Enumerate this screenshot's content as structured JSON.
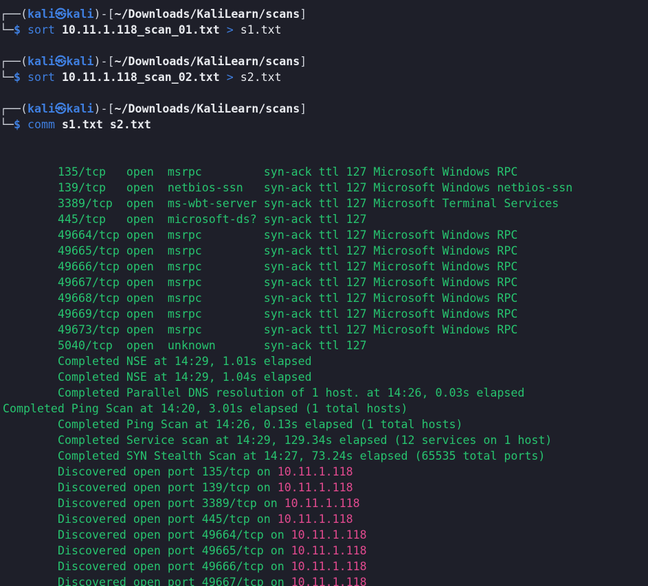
{
  "prompts": [
    {
      "user": "kali",
      "host": "kali",
      "path": "~/Downloads/KaliLearn/scans",
      "command": "sort",
      "arg_bold": "10.11.1.118_scan_01.txt",
      "redirect": ">",
      "arg_plain": "s1.txt"
    },
    {
      "user": "kali",
      "host": "kali",
      "path": "~/Downloads/KaliLearn/scans",
      "command": "sort",
      "arg_bold": "10.11.1.118_scan_02.txt",
      "redirect": ">",
      "arg_plain": "s2.txt"
    },
    {
      "user": "kali",
      "host": "kali",
      "path": "~/Downloads/KaliLearn/scans",
      "command": "comm",
      "arg_bold": "s1.txt s2.txt",
      "redirect": "",
      "arg_plain": ""
    }
  ],
  "output": {
    "ports": [
      "135/tcp   open  msrpc         syn-ack ttl 127 Microsoft Windows RPC",
      "139/tcp   open  netbios-ssn   syn-ack ttl 127 Microsoft Windows netbios-ssn",
      "3389/tcp  open  ms-wbt-server syn-ack ttl 127 Microsoft Terminal Services",
      "445/tcp   open  microsoft-ds? syn-ack ttl 127",
      "49664/tcp open  msrpc         syn-ack ttl 127 Microsoft Windows RPC",
      "49665/tcp open  msrpc         syn-ack ttl 127 Microsoft Windows RPC",
      "49666/tcp open  msrpc         syn-ack ttl 127 Microsoft Windows RPC",
      "49667/tcp open  msrpc         syn-ack ttl 127 Microsoft Windows RPC",
      "49668/tcp open  msrpc         syn-ack ttl 127 Microsoft Windows RPC",
      "49669/tcp open  msrpc         syn-ack ttl 127 Microsoft Windows RPC",
      "49673/tcp open  msrpc         syn-ack ttl 127 Microsoft Windows RPC",
      "5040/tcp  open  unknown       syn-ack ttl 127"
    ],
    "completed_indented_1": [
      "Completed NSE at 14:29, 1.01s elapsed",
      "Completed NSE at 14:29, 1.04s elapsed",
      "Completed Parallel DNS resolution of 1 host. at 14:26, 0.03s elapsed"
    ],
    "completed_unindented": "Completed Ping Scan at 14:20, 3.01s elapsed (1 total hosts)",
    "completed_indented_2": [
      "Completed Ping Scan at 14:26, 0.13s elapsed (1 total hosts)",
      "Completed Service scan at 14:29, 129.34s elapsed (12 services on 1 host)",
      "Completed SYN Stealth Scan at 14:27, 73.24s elapsed (65535 total ports)"
    ],
    "discovered": [
      {
        "text": "Discovered open port 135/tcp on ",
        "ip": "10.11.1.118"
      },
      {
        "text": "Discovered open port 139/tcp on ",
        "ip": "10.11.1.118"
      },
      {
        "text": "Discovered open port 3389/tcp on ",
        "ip": "10.11.1.118"
      },
      {
        "text": "Discovered open port 445/tcp on ",
        "ip": "10.11.1.118"
      },
      {
        "text": "Discovered open port 49664/tcp on ",
        "ip": "10.11.1.118"
      },
      {
        "text": "Discovered open port 49665/tcp on ",
        "ip": "10.11.1.118"
      },
      {
        "text": "Discovered open port 49666/tcp on ",
        "ip": "10.11.1.118"
      },
      {
        "text": "Discovered open port 49667/tcp on ",
        "ip": "10.11.1.118"
      }
    ]
  },
  "colors": {
    "background": "#1e1f29",
    "prompt": "#3f7fe0",
    "output_green": "#27c46f",
    "ip_pink": "#e24a8f"
  }
}
